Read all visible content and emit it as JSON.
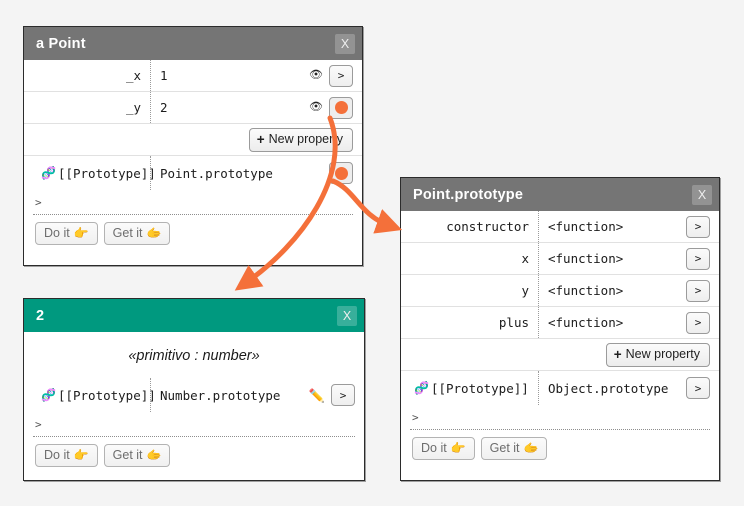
{
  "panels": {
    "point": {
      "title": "a Point",
      "close_label": "X",
      "header_color": "#757575",
      "rows": [
        {
          "key": "_x",
          "value": "1",
          "eye_icon": "eye-icon",
          "button_label": ">"
        },
        {
          "key": "_y",
          "value": "2",
          "eye_icon": "eye-icon",
          "button_label": ">"
        }
      ],
      "new_property_label": "New property",
      "new_property_plus": "+",
      "prototype": {
        "icon": "prototype-icon",
        "key": "[[Prototype]]",
        "value": "Point.prototype",
        "button_label": ">"
      },
      "prompt": ">",
      "do_it_label": "Do it",
      "do_it_icon": "pointing-right-hand-icon",
      "get_it_label": "Get it",
      "get_it_icon": "grabbing-hand-icon"
    },
    "number": {
      "title": "2",
      "close_label": "X",
      "header_color": "#00997f",
      "caption": "«primitivo : number»",
      "prototype": {
        "icon": "prototype-icon",
        "key": "[[Prototype]]",
        "value": "Number.prototype",
        "pencil_icon": "pencil-icon",
        "button_label": ">"
      },
      "prompt": ">",
      "do_it_label": "Do it",
      "do_it_icon": "pointing-right-hand-icon",
      "get_it_label": "Get it",
      "get_it_icon": "grabbing-hand-icon"
    },
    "prototype": {
      "title": "Point.prototype",
      "close_label": "X",
      "header_color": "#757575",
      "rows": [
        {
          "key": "constructor",
          "value": "<function>",
          "button_label": ">"
        },
        {
          "key": "x",
          "value": "<function>",
          "button_label": ">"
        },
        {
          "key": "y",
          "value": "<function>",
          "button_label": ">"
        },
        {
          "key": "plus",
          "value": "<function>",
          "button_label": ">"
        }
      ],
      "new_property_label": "New property",
      "new_property_plus": "+",
      "prototype": {
        "icon": "prototype-icon",
        "key": "[[Prototype]]",
        "value": "Object.prototype",
        "button_label": ">"
      },
      "prompt": ">",
      "do_it_label": "Do it",
      "do_it_icon": "pointing-right-hand-icon",
      "get_it_label": "Get it",
      "get_it_icon": "grabbing-hand-icon"
    }
  },
  "icons": {
    "prototype_glyph": "🧬",
    "eye_glyph": "👁",
    "pencil_glyph": "✏️",
    "pointing_hand_glyph": "👉",
    "grabbing_hand_glyph": "🫱"
  },
  "arrows": {
    "color": "#f4703a",
    "connections": [
      {
        "from": "point._y-button",
        "to": "number-panel-header"
      },
      {
        "from": "point.prototype-button",
        "to": "prototype-panel-header"
      }
    ]
  }
}
